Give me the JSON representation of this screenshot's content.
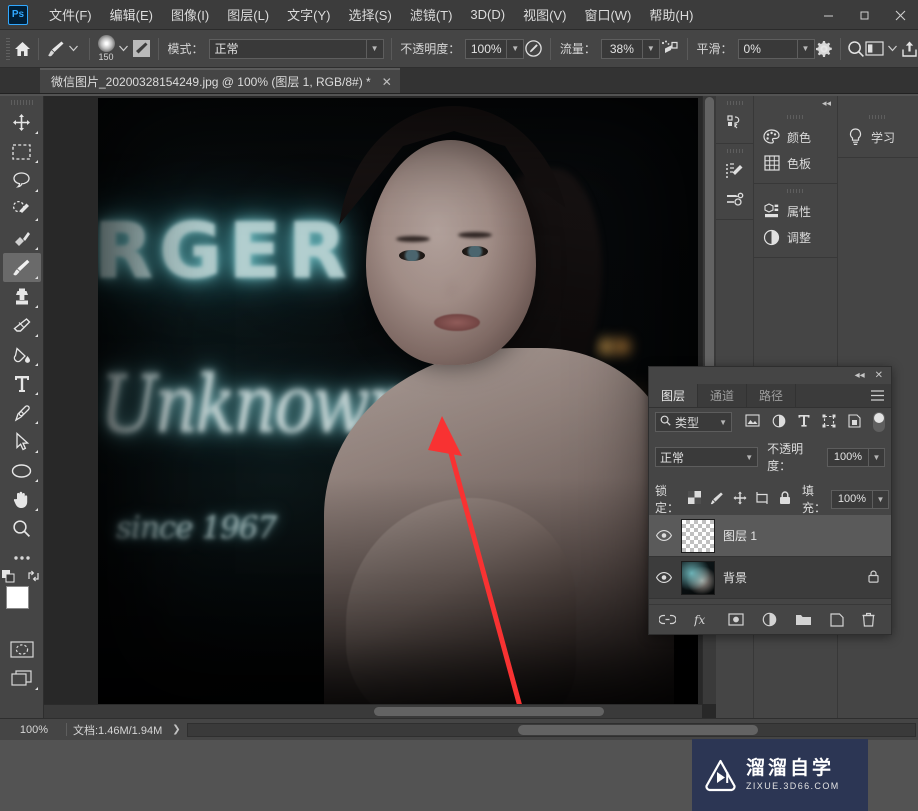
{
  "app": {
    "logo_text": "Ps"
  },
  "menubar": {
    "items": [
      {
        "label": "文件(F)",
        "name": "menu-file"
      },
      {
        "label": "编辑(E)",
        "name": "menu-edit"
      },
      {
        "label": "图像(I)",
        "name": "menu-image"
      },
      {
        "label": "图层(L)",
        "name": "menu-layer"
      },
      {
        "label": "文字(Y)",
        "name": "menu-type"
      },
      {
        "label": "选择(S)",
        "name": "menu-select"
      },
      {
        "label": "滤镜(T)",
        "name": "menu-filter"
      },
      {
        "label": "3D(D)",
        "name": "menu-3d"
      },
      {
        "label": "视图(V)",
        "name": "menu-view"
      },
      {
        "label": "窗口(W)",
        "name": "menu-window"
      },
      {
        "label": "帮助(H)",
        "name": "menu-help"
      }
    ],
    "window_controls": {
      "minimize": "—",
      "maximize": "▢",
      "close": "✕"
    }
  },
  "options_bar": {
    "home_icon": "home-icon",
    "brush_size": "150",
    "mode_label": "模式：",
    "mode_value": "正常",
    "opacity_label": "不透明度：",
    "opacity_value": "100%",
    "flow_label": "流量：",
    "flow_value": "38%",
    "smoothing_label": "平滑：",
    "smoothing_value": "0%"
  },
  "document_tab": {
    "title": "微信图片_20200328154249.jpg @ 100% (图层 1, RGB/8#) *",
    "close": "✕"
  },
  "toolbar": {
    "tools": [
      {
        "name": "move-tool",
        "label": "移动工具"
      },
      {
        "name": "marquee-tool",
        "label": "矩形选框工具"
      },
      {
        "name": "lasso-tool",
        "label": "套索工具"
      },
      {
        "name": "quick-selection-tool",
        "label": "快速选择工具"
      },
      {
        "name": "healing-brush-tool",
        "label": "污点修复画笔工具"
      },
      {
        "name": "brush-tool",
        "label": "画笔工具",
        "active": true
      },
      {
        "name": "clone-stamp-tool",
        "label": "仿制图章工具"
      },
      {
        "name": "eraser-tool",
        "label": "橡皮擦工具"
      },
      {
        "name": "paint-bucket-tool",
        "label": "油漆桶工具"
      },
      {
        "name": "type-tool",
        "label": "横排文字工具"
      },
      {
        "name": "pen-tool",
        "label": "钢笔工具"
      },
      {
        "name": "path-selection-tool",
        "label": "路径选择工具"
      },
      {
        "name": "ellipse-tool",
        "label": "椭圆工具"
      },
      {
        "name": "hand-tool",
        "label": "抓手工具"
      },
      {
        "name": "zoom-tool",
        "label": "缩放工具"
      },
      {
        "name": "more-tools",
        "label": "编辑工具栏"
      }
    ],
    "foreground_color": "#ffffff",
    "background_color": "#000000"
  },
  "right_dock": {
    "groups": [
      {
        "items": [
          {
            "label": "颜色",
            "icon": "color-palette-icon",
            "name": "panel-color"
          },
          {
            "label": "色板",
            "icon": "swatches-grid-icon",
            "name": "panel-swatches"
          }
        ]
      },
      {
        "items": [
          {
            "label": "属性",
            "icon": "properties-icon",
            "name": "panel-properties"
          },
          {
            "label": "调整",
            "icon": "adjustments-icon",
            "name": "panel-adjustments"
          }
        ]
      }
    ],
    "learn": {
      "label": "学习",
      "icon": "lightbulb-icon",
      "name": "panel-learn"
    }
  },
  "layers_panel": {
    "tabs": [
      {
        "label": "图层",
        "active": true
      },
      {
        "label": "通道",
        "active": false
      },
      {
        "label": "路径",
        "active": false
      }
    ],
    "filter": {
      "value": "类型",
      "icon": "search-icon"
    },
    "filter_type_icons": [
      "image-filter-icon",
      "adjustment-filter-icon",
      "type-filter-icon",
      "shape-filter-icon",
      "smart-object-filter-icon"
    ],
    "blend_mode": "正常",
    "opacity_label": "不透明度：",
    "opacity_value": "100%",
    "lock_label": "锁定：",
    "lock_icons": [
      "lock-transparent-icon",
      "lock-image-icon",
      "lock-position-icon",
      "lock-artboard-icon",
      "lock-all-icon"
    ],
    "fill_label": "填充：",
    "fill_value": "100%",
    "layers": [
      {
        "name": "图层 1",
        "selected": true,
        "visible": true,
        "locked": false,
        "thumb": "transparent"
      },
      {
        "name": "背景",
        "selected": false,
        "visible": true,
        "locked": true,
        "thumb": "photo"
      }
    ],
    "footer_icons": [
      "link-layers-icon",
      "layer-style-fx-icon",
      "layer-mask-icon",
      "adjustment-layer-icon",
      "new-group-icon",
      "new-layer-icon",
      "delete-layer-icon"
    ]
  },
  "status_bar": {
    "zoom": "100%",
    "doc_info": "文档:1.46M/1.94M",
    "expand": "❯"
  },
  "canvas": {
    "neon_top_text": "RGER",
    "neon_script_text": "Unknown",
    "neon_sub_text": "since 1967",
    "annotation_arrow_color": "#f83232"
  },
  "watermark": {
    "main_text": "溜溜自学",
    "sub_text": "ZIXUE.3D66.COM",
    "bg_color": "#2c3654"
  }
}
